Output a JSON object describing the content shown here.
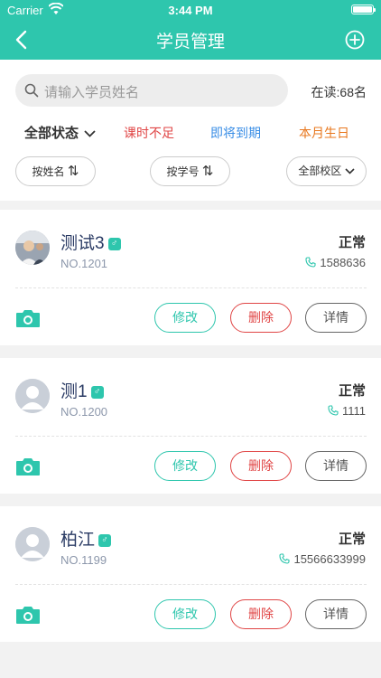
{
  "status_bar": {
    "carrier": "Carrier",
    "time": "3:44 PM"
  },
  "nav": {
    "title": "学员管理"
  },
  "search": {
    "placeholder": "请输入学员姓名"
  },
  "reading_count": "在读:68名",
  "filters": {
    "status": "全部状态",
    "low_hours": "课时不足",
    "expiring": "即将到期",
    "birthday": "本月生日"
  },
  "sort": {
    "by_name": "按姓名",
    "by_id": "按学号",
    "campus": "全部校区",
    "sort_glyph": "⇅"
  },
  "students": [
    {
      "name": "测试3",
      "gender": "♂",
      "number": "NO.1201",
      "status": "正常",
      "phone": "1588636",
      "has_photo": true
    },
    {
      "name": "测1",
      "gender": "♂",
      "number": "NO.1200",
      "status": "正常",
      "phone": "1111",
      "has_photo": false
    },
    {
      "name": "柏江",
      "gender": "♂",
      "number": "NO.1199",
      "status": "正常",
      "phone": "15566633999",
      "has_photo": false
    }
  ],
  "actions": {
    "edit": "修改",
    "delete": "删除",
    "detail": "详情"
  },
  "colors": {
    "brand": "#2ec6ad",
    "danger": "#e04545",
    "info": "#3a8ee6",
    "warning": "#e8781f"
  }
}
